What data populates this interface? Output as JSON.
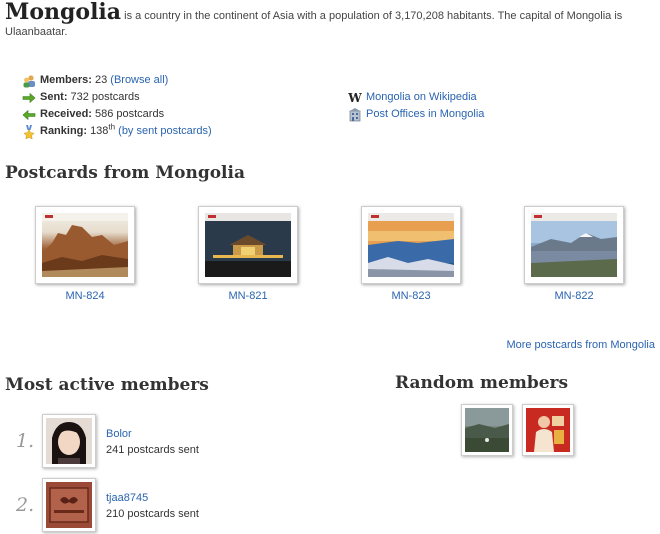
{
  "country": {
    "name": "Mongolia",
    "description": "is a country in the continent of Asia with a population of 3,170,208 habitants. The capital of Mongolia is Ulaanbaatar."
  },
  "stats": {
    "members_label": "Members:",
    "members_value": "23",
    "browse_all": "(Browse all)",
    "sent_label": "Sent:",
    "sent_value": "732 postcards",
    "received_label": "Received:",
    "received_value": "586 postcards",
    "ranking_label": "Ranking:",
    "ranking_value": "138",
    "ranking_suffix": "th",
    "ranking_link": "(by sent postcards)"
  },
  "external_links": {
    "wikipedia": "Mongolia on Wikipedia",
    "post_offices": "Post Offices in Mongolia"
  },
  "postcards": {
    "title": "Postcards from Mongolia",
    "items": [
      {
        "id": "MN-824"
      },
      {
        "id": "MN-821"
      },
      {
        "id": "MN-823"
      },
      {
        "id": "MN-822"
      }
    ],
    "more_link": "More postcards from Mongolia"
  },
  "active_members": {
    "title": "Most active members",
    "items": [
      {
        "rank": "1.",
        "name": "Bolor",
        "sent": "241 postcards sent"
      },
      {
        "rank": "2.",
        "name": "tjaa8745",
        "sent": "210 postcards sent"
      }
    ]
  },
  "random_members": {
    "title": "Random members"
  },
  "icons": {
    "members": "members-icon",
    "sent": "green-arrow-right-icon",
    "received": "green-arrow-left-icon",
    "ranking": "star-medal-icon",
    "wikipedia": "wikipedia-w-icon",
    "post_offices": "building-icon"
  }
}
